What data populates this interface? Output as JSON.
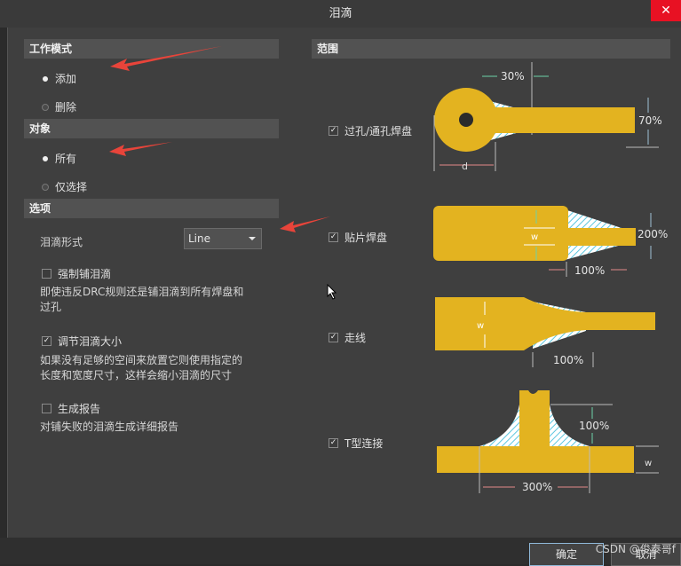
{
  "title": "泪滴",
  "close_symbol": "✕",
  "work_mode": {
    "header": "工作模式",
    "options": [
      "添加",
      "删除"
    ],
    "selected": "添加"
  },
  "object": {
    "header": "对象",
    "options": [
      "所有",
      "仅选择"
    ],
    "selected": "所有"
  },
  "options_section": {
    "header": "选项",
    "teardrop_style_label": "泪滴形式",
    "teardrop_style_value": "Line",
    "force_teardrop": {
      "label": "强制铺泪滴",
      "checked": false,
      "description": [
        "即使违反DRC规则还是铺泪滴到所有焊盘和",
        "过孔"
      ]
    },
    "adjust_size": {
      "label": "调节泪滴大小",
      "checked": true,
      "description": [
        "如果没有足够的空间来放置它则使用指定的",
        "长度和宽度尺寸，这样会缩小泪滴的尺寸"
      ]
    },
    "generate_report": {
      "label": "生成报告",
      "checked": false,
      "description": [
        "对铺失败的泪滴生成详细报告"
      ]
    }
  },
  "scope": {
    "header": "范围",
    "items": [
      {
        "label": "过孔/通孔焊盘",
        "checked": true,
        "pct_len": "30%",
        "pct_width": "70%",
        "dim_label": "d"
      },
      {
        "label": "贴片焊盘",
        "checked": true,
        "pct_len": "100%",
        "pct_width": "200%",
        "dim_label": "w"
      },
      {
        "label": "走线",
        "checked": true,
        "pct_len": "100%",
        "dim_label": "w"
      },
      {
        "label": "T型连接",
        "checked": true,
        "pct_len": "300%",
        "pct_height": "100%",
        "dim_label": "w"
      }
    ]
  },
  "buttons": {
    "ok": "确定",
    "cancel": "取消"
  },
  "watermark": "CSDN @俊泰哥f",
  "colors": {
    "copper": "#e3b320",
    "teardrop_hatch": "#7fd3e6",
    "arrow_red": "#e8443a"
  }
}
